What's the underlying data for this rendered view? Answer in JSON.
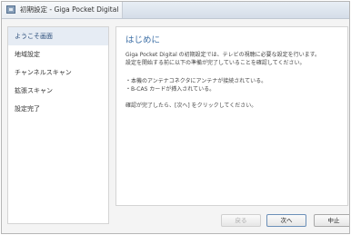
{
  "window": {
    "title": "初期設定 - Giga Pocket Digital"
  },
  "sidebar": {
    "items": [
      {
        "label": "ようこそ画面"
      },
      {
        "label": "地域設定"
      },
      {
        "label": "チャンネルスキャン"
      },
      {
        "label": "拡張スキャン"
      },
      {
        "label": "設定完了"
      }
    ]
  },
  "main": {
    "heading": "はじめに",
    "intro_line1": "Giga Pocket Digital の初期設定では、テレビの視聴に必要な設定を行います。",
    "intro_line2": "設定を開始する前に以下の準備が完了していることを確認してください。",
    "bullet1": "・本機のアンテナコネクタにアンテナが接続されている。",
    "bullet2": "・B-CAS カードが挿入されている。",
    "outro": "確認が完了したら、[次へ] をクリックしてください。"
  },
  "buttons": {
    "back": "戻る",
    "next": "次へ",
    "cancel": "中止"
  }
}
